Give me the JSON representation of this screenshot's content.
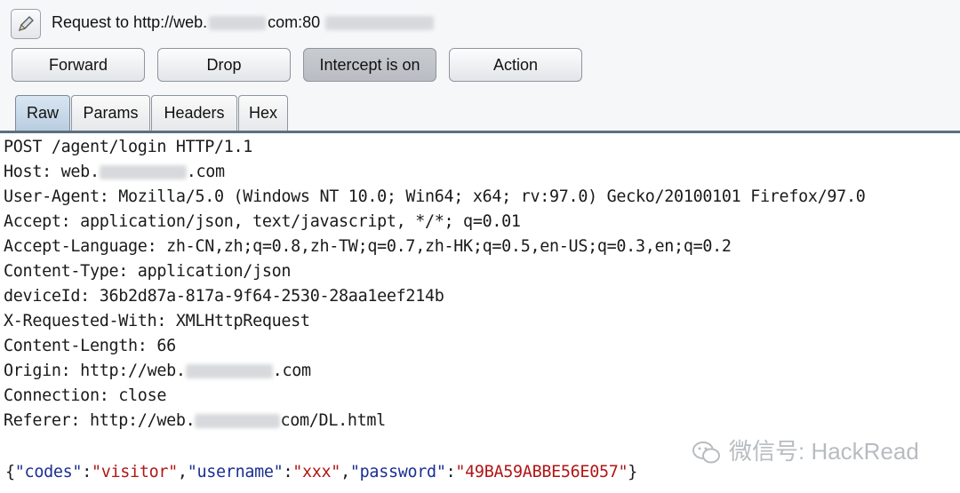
{
  "header": {
    "request_prefix": "Request to http://web.",
    "request_suffix": "com:80",
    "edit_icon": "pencil-icon"
  },
  "toolbar": {
    "forward": "Forward",
    "drop": "Drop",
    "intercept": "Intercept is on",
    "action": "Action"
  },
  "tabs": [
    "Raw",
    "Params",
    "Headers",
    "Hex"
  ],
  "request": {
    "lines": {
      "l1": "POST /agent/login HTTP/1.1",
      "l2a": "Host: web.",
      "l2b": ".com",
      "l3": "User-Agent: Mozilla/5.0 (Windows NT 10.0; Win64; x64; rv:97.0) Gecko/20100101 Firefox/97.0",
      "l4": "Accept: application/json, text/javascript, */*; q=0.01",
      "l5": "Accept-Language: zh-CN,zh;q=0.8,zh-TW;q=0.7,zh-HK;q=0.5,en-US;q=0.3,en;q=0.2",
      "l6": "Content-Type: application/json",
      "l7": "deviceId: 36b2d87a-817a-9f64-2530-28aa1eef214b",
      "l8": "X-Requested-With: XMLHttpRequest",
      "l9": "Content-Length: 66",
      "l10a": "Origin: http://web.",
      "l10b": ".com",
      "l11": "Connection: close",
      "l12a": "Referer: http://web.",
      "l12b": "com/DL.html"
    },
    "body": {
      "k1": "\"codes\"",
      "v1": "\"visitor\"",
      "k2": "\"username\"",
      "v2": "\"xxx\"",
      "k3": "\"password\"",
      "v3": "\"49BA59ABBE56E057\"",
      "open": "{",
      "close": "}",
      "colon": ":",
      "comma": ","
    }
  },
  "watermark": "微信号: HackRead",
  "colors": {
    "json_key": "#1b2f8f",
    "json_value": "#b01616",
    "active_tab": "#c5d7e8"
  }
}
